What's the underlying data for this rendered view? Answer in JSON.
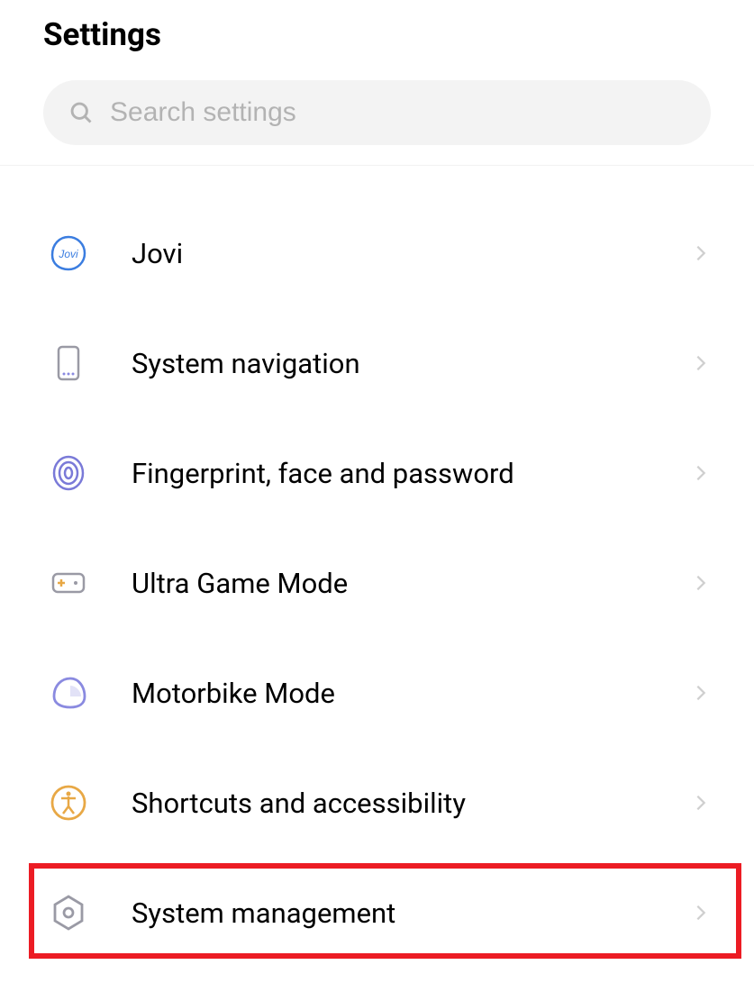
{
  "header": {
    "title": "Settings"
  },
  "search": {
    "placeholder": "Search settings"
  },
  "items": [
    {
      "label": "Jovi"
    },
    {
      "label": "System navigation"
    },
    {
      "label": "Fingerprint, face and password"
    },
    {
      "label": "Ultra Game Mode"
    },
    {
      "label": "Motorbike Mode"
    },
    {
      "label": "Shortcuts and accessibility"
    },
    {
      "label": "System management"
    }
  ]
}
